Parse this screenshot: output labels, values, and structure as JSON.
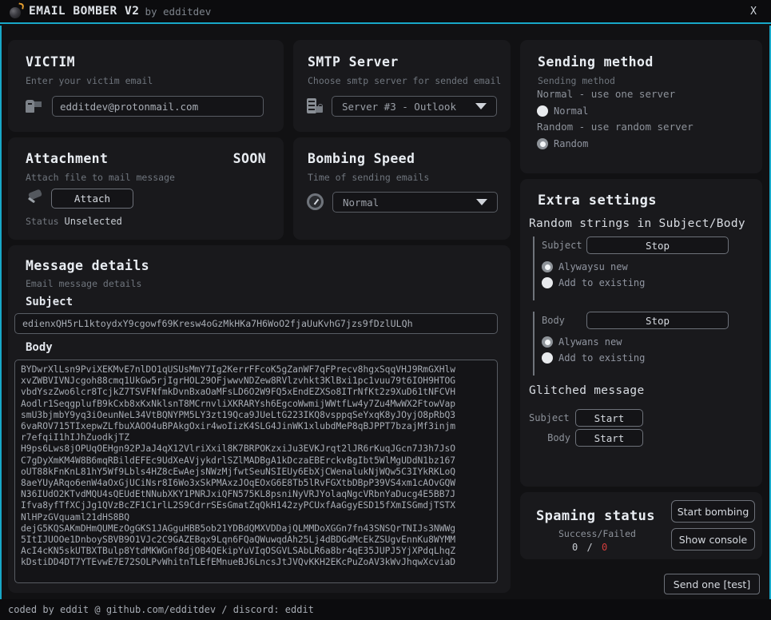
{
  "titlebar": {
    "title": "EMAIL BOMBER V2",
    "byline": "by edditdev",
    "close": "X",
    "icon": "bomb-icon",
    "accent_color": "#18a8c8"
  },
  "victim": {
    "title": "VICTIM",
    "subtitle": "Enter your victim email",
    "icon": "mailbox-icon",
    "email_value": "edditdev@protonmail.com",
    "email_placeholder": "edditdev@protonmail.com"
  },
  "smtp": {
    "title": "SMTP Server",
    "subtitle": "Choose smtp server for sended email",
    "icon": "server-icon",
    "selected": "Server #3 - Outlook"
  },
  "attachment": {
    "title": "Attachment",
    "badge": "SOON",
    "subtitle": "Attach file to mail message",
    "icon": "pushpin-icon",
    "button": "Attach",
    "status_label": "Status",
    "status_value": "Unselected"
  },
  "speed": {
    "title": "Bombing Speed",
    "subtitle": "Time of sending emails",
    "icon": "speedometer-icon",
    "selected": "Normal"
  },
  "sending_method": {
    "title": "Sending method",
    "subtitle": "Sending method",
    "normal_desc": "Normal - use one server",
    "normal_label": "Normal",
    "normal_checked": false,
    "random_desc": "Random - use random server",
    "random_label": "Random",
    "random_checked": true
  },
  "extra": {
    "title": "Extra settings",
    "random_strings_head": "Random strings in Subject/Body",
    "subject_label": "Subject",
    "subject_button": "Stop",
    "subject_opt1": "Alywaysu new",
    "subject_opt1_checked": true,
    "subject_opt2": "Add to existing",
    "subject_opt2_checked": false,
    "body_label": "Body",
    "body_button": "Stop",
    "body_opt1": "Alywans new",
    "body_opt1_checked": true,
    "body_opt2": "Add to existing",
    "body_opt2_checked": false,
    "glitched_head": "Glitched message",
    "glitch_subject_label": "Subject",
    "glitch_subject_button": "Start",
    "glitch_body_label": "Body",
    "glitch_body_button": "Start"
  },
  "message": {
    "title": "Message details",
    "subtitle": "Email message details",
    "subject_label": "Subject",
    "subject_value": "edienxQH5rL1ktoydxY9cgowf69Kresw4oGzMkHKa7H6WoO2fjaUuKvhG7jzs9fDzlULQh",
    "body_label": "Body",
    "body_value": "BYDwrXlLsn9PviXEKMvE7nlDO1qUSUsMmY7Ig2KerrFFcoK5gZanWF7qFPrecv8hgxSqqVHJ9RmGXHlw\nxvZWBVIVNJcgoh88cmq1UkGw5rjIgrHOL29OFjwwvNDZew8RVlzvhkt3KlBxi1pc1vuu79t6IOH9HTOG\nvbdYszZwo6lcr8TcjkZ7TSVFNfmkDvnBxaOaMFsLD6O2W9FQ5xEndEZXSo8ITrNfKt2z9XuD61tNFCVH\nAodlr1SeqgplufB9kCxb8xKxNklsnT8MCrnvliXKRARYsh6EgcoWwmijWWtfLw4y7Zu4MwWX2FtowVap\nsmU3bjmbY9yq3iOeunNeL34VtBQNYPM5LY3zt19Qca9JUeLtG223IKQ8vsppqSeYxqK8yJOyjO8pRbQ3\n6vaROV715TIxepwZLfbuXAOO4uBPAkgOxir4woIizK4SLG4JinWK1xlubdMeP8qBJPPT7bzajMf3injm\nr7efqiI1hIJhZuodkjTZ\nH9ps6Lws8jOPUqOEHgn92PJaJ4qX12VlriXxil8K7BRPOKzxiJu3EVKJrqt2lJR6rKuqJGcn7J3h7JsO\nC7gDyXmKM4W8B6mqRBildEFEc9UdXeAVjykdrlSZlMADBgA1kDczaEBErckvBgIbt5WlMgUDdN1bz167\noUT88kFnKnL81hY5Wf9Lbls4HZ8cEwAejsNWzMjfwtSeuNSIEUy6EbXjCWenalukNjWQw5C3IYkRKLoQ\n8aeYUyARqo6enW4aOxGjUCiNsr8I6Wo3xSkPMAxzJOqEOxG6E8Tb5lRvFGXtbDBpP39VS4xm1cAOvGQW\nN36IUdO2KTvdMQU4sQEUdEtNNubXKY1PNRJxiQFN575KL8psniNyVRJYolaqNgcVRbnYaDucg4E5BB7J\nIfva8yfTfXCjJg1QVzBcZF1C1rlL2S9CdrrSEsGmatZqQkH142zyPCUxfAaGgyESD15fXmISGmdjTSTX\nNlHPzGVquaml21dHS8BQ\ndejG5KQSAKmDHmQUMEzOgGKS1JAGguHBB5ob21YDBdQMXVDDajQLMMDoXGGn7fn43SNSQrTNIJs3NWWg\n5ItIJUOOe1DnboySBVB9O1VJc2C9GAZEBqx9Lqn6FQaQWuwqdAh25Lj4dBDGdMcEkZSUgvEnnKu8WYMM\nAcI4cKN5skUTBXTBulp8YtdMKWGnf8djOB4QEkipYuVIqOSGVLSAbLR6a8br4qE35JUPJ5YjXPdqLhqZ\nkDstiDD4DT7YTEvwE7E72SOLPvWhitnTLEfEMnueBJ6LncsJtJVQvKKH2EKcPuZoAV3kWvJhqwXcviaD"
  },
  "spaming": {
    "title": "Spaming status",
    "counter_label": "Success/Failed",
    "success": "0",
    "separator": "/",
    "failed": "0",
    "failed_color": "#d43d3d",
    "start_button": "Start bombing",
    "console_button": "Show console"
  },
  "footer": {
    "send_test_button": "Send one [test]",
    "credits": "coded by eddit @ github.com/edditdev / discord: eddit"
  }
}
